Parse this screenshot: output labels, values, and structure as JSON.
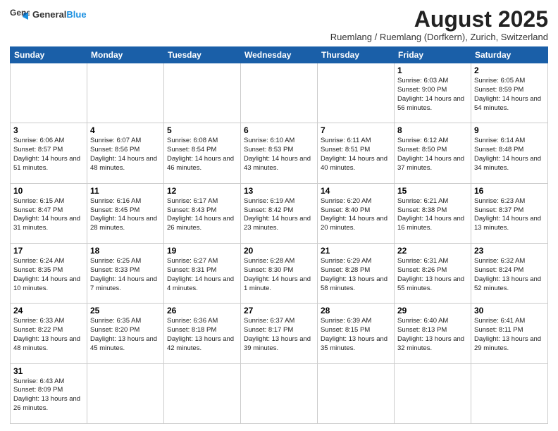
{
  "header": {
    "logo_text_normal": "General",
    "logo_text_blue": "Blue",
    "main_title": "August 2025",
    "subtitle": "Ruemlang / Ruemlang (Dorfkern), Zurich, Switzerland"
  },
  "days_of_week": [
    "Sunday",
    "Monday",
    "Tuesday",
    "Wednesday",
    "Thursday",
    "Friday",
    "Saturday"
  ],
  "weeks": [
    [
      {
        "num": "",
        "info": ""
      },
      {
        "num": "",
        "info": ""
      },
      {
        "num": "",
        "info": ""
      },
      {
        "num": "",
        "info": ""
      },
      {
        "num": "",
        "info": ""
      },
      {
        "num": "1",
        "info": "Sunrise: 6:03 AM\nSunset: 9:00 PM\nDaylight: 14 hours and 56 minutes."
      },
      {
        "num": "2",
        "info": "Sunrise: 6:05 AM\nSunset: 8:59 PM\nDaylight: 14 hours and 54 minutes."
      }
    ],
    [
      {
        "num": "3",
        "info": "Sunrise: 6:06 AM\nSunset: 8:57 PM\nDaylight: 14 hours and 51 minutes."
      },
      {
        "num": "4",
        "info": "Sunrise: 6:07 AM\nSunset: 8:56 PM\nDaylight: 14 hours and 48 minutes."
      },
      {
        "num": "5",
        "info": "Sunrise: 6:08 AM\nSunset: 8:54 PM\nDaylight: 14 hours and 46 minutes."
      },
      {
        "num": "6",
        "info": "Sunrise: 6:10 AM\nSunset: 8:53 PM\nDaylight: 14 hours and 43 minutes."
      },
      {
        "num": "7",
        "info": "Sunrise: 6:11 AM\nSunset: 8:51 PM\nDaylight: 14 hours and 40 minutes."
      },
      {
        "num": "8",
        "info": "Sunrise: 6:12 AM\nSunset: 8:50 PM\nDaylight: 14 hours and 37 minutes."
      },
      {
        "num": "9",
        "info": "Sunrise: 6:14 AM\nSunset: 8:48 PM\nDaylight: 14 hours and 34 minutes."
      }
    ],
    [
      {
        "num": "10",
        "info": "Sunrise: 6:15 AM\nSunset: 8:47 PM\nDaylight: 14 hours and 31 minutes."
      },
      {
        "num": "11",
        "info": "Sunrise: 6:16 AM\nSunset: 8:45 PM\nDaylight: 14 hours and 28 minutes."
      },
      {
        "num": "12",
        "info": "Sunrise: 6:17 AM\nSunset: 8:43 PM\nDaylight: 14 hours and 26 minutes."
      },
      {
        "num": "13",
        "info": "Sunrise: 6:19 AM\nSunset: 8:42 PM\nDaylight: 14 hours and 23 minutes."
      },
      {
        "num": "14",
        "info": "Sunrise: 6:20 AM\nSunset: 8:40 PM\nDaylight: 14 hours and 20 minutes."
      },
      {
        "num": "15",
        "info": "Sunrise: 6:21 AM\nSunset: 8:38 PM\nDaylight: 14 hours and 16 minutes."
      },
      {
        "num": "16",
        "info": "Sunrise: 6:23 AM\nSunset: 8:37 PM\nDaylight: 14 hours and 13 minutes."
      }
    ],
    [
      {
        "num": "17",
        "info": "Sunrise: 6:24 AM\nSunset: 8:35 PM\nDaylight: 14 hours and 10 minutes."
      },
      {
        "num": "18",
        "info": "Sunrise: 6:25 AM\nSunset: 8:33 PM\nDaylight: 14 hours and 7 minutes."
      },
      {
        "num": "19",
        "info": "Sunrise: 6:27 AM\nSunset: 8:31 PM\nDaylight: 14 hours and 4 minutes."
      },
      {
        "num": "20",
        "info": "Sunrise: 6:28 AM\nSunset: 8:30 PM\nDaylight: 14 hours and 1 minute."
      },
      {
        "num": "21",
        "info": "Sunrise: 6:29 AM\nSunset: 8:28 PM\nDaylight: 13 hours and 58 minutes."
      },
      {
        "num": "22",
        "info": "Sunrise: 6:31 AM\nSunset: 8:26 PM\nDaylight: 13 hours and 55 minutes."
      },
      {
        "num": "23",
        "info": "Sunrise: 6:32 AM\nSunset: 8:24 PM\nDaylight: 13 hours and 52 minutes."
      }
    ],
    [
      {
        "num": "24",
        "info": "Sunrise: 6:33 AM\nSunset: 8:22 PM\nDaylight: 13 hours and 48 minutes."
      },
      {
        "num": "25",
        "info": "Sunrise: 6:35 AM\nSunset: 8:20 PM\nDaylight: 13 hours and 45 minutes."
      },
      {
        "num": "26",
        "info": "Sunrise: 6:36 AM\nSunset: 8:18 PM\nDaylight: 13 hours and 42 minutes."
      },
      {
        "num": "27",
        "info": "Sunrise: 6:37 AM\nSunset: 8:17 PM\nDaylight: 13 hours and 39 minutes."
      },
      {
        "num": "28",
        "info": "Sunrise: 6:39 AM\nSunset: 8:15 PM\nDaylight: 13 hours and 35 minutes."
      },
      {
        "num": "29",
        "info": "Sunrise: 6:40 AM\nSunset: 8:13 PM\nDaylight: 13 hours and 32 minutes."
      },
      {
        "num": "30",
        "info": "Sunrise: 6:41 AM\nSunset: 8:11 PM\nDaylight: 13 hours and 29 minutes."
      }
    ],
    [
      {
        "num": "31",
        "info": "Sunrise: 6:43 AM\nSunset: 8:09 PM\nDaylight: 13 hours and 26 minutes."
      },
      {
        "num": "",
        "info": ""
      },
      {
        "num": "",
        "info": ""
      },
      {
        "num": "",
        "info": ""
      },
      {
        "num": "",
        "info": ""
      },
      {
        "num": "",
        "info": ""
      },
      {
        "num": "",
        "info": ""
      }
    ]
  ]
}
